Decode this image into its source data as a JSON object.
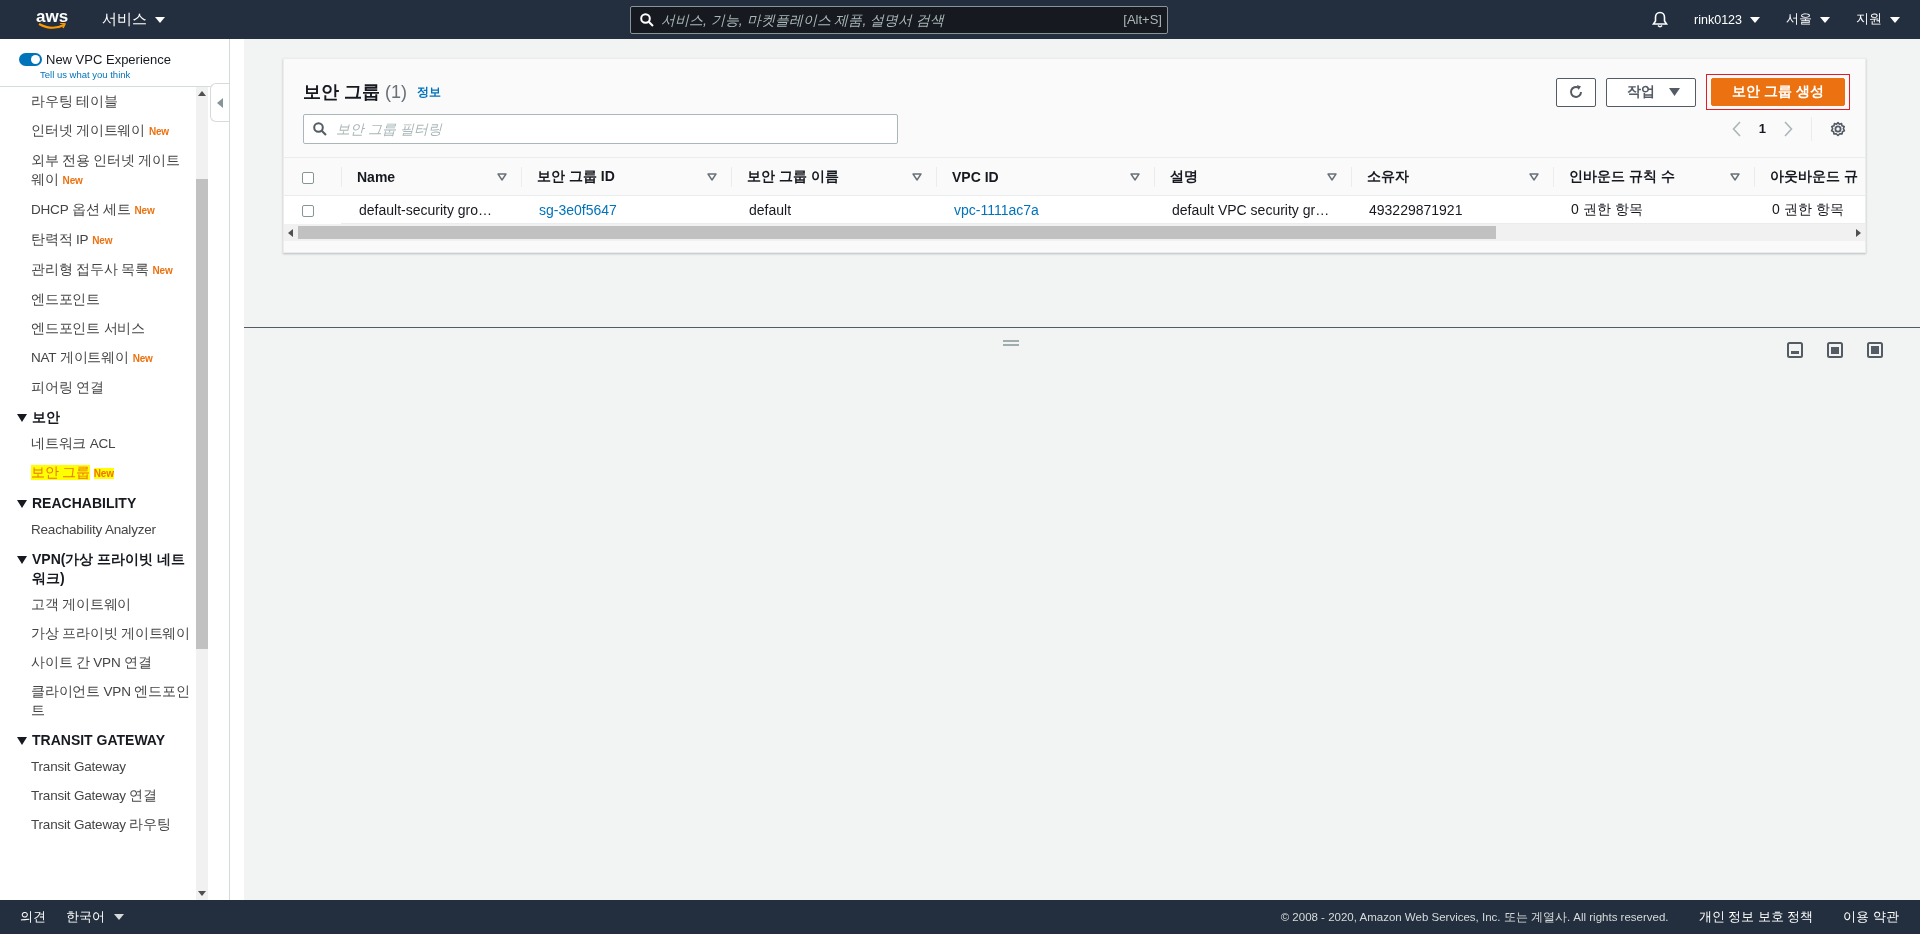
{
  "top_bar": {
    "logo": "aws",
    "services": "서비스",
    "search": {
      "placeholder": "서비스, 기능, 마켓플레이스 제품, 설명서 검색",
      "shortcut": "[Alt+S]"
    },
    "account": "rink0123",
    "region": "서울",
    "support": "지원"
  },
  "sidebar": {
    "toggle": {
      "label": "New VPC Experience",
      "on": true
    },
    "feedback_link": "Tell us what you think",
    "groups": [
      {
        "items": [
          {
            "label": "라우팅 테이블",
            "selected": false
          },
          {
            "label": "인터넷 게이트웨이",
            "badge": "New",
            "selected": false
          },
          {
            "label": "외부 전용 인터넷 게이트웨이",
            "badge": "New",
            "selected": false
          },
          {
            "label": "DHCP 옵션 세트",
            "badge": "New",
            "selected": false
          },
          {
            "label": "탄력적 IP",
            "badge": "New",
            "selected": false
          },
          {
            "label": "관리형 접두사 목록",
            "badge": "New",
            "selected": false
          },
          {
            "label": "엔드포인트",
            "selected": false
          },
          {
            "label": "엔드포인트 서비스",
            "selected": false
          },
          {
            "label": "NAT 게이트웨이",
            "badge": "New",
            "selected": false
          },
          {
            "label": "피어링 연결",
            "selected": false
          }
        ]
      },
      {
        "title": "보안",
        "expanded": true,
        "items": [
          {
            "label": "네트워크 ACL",
            "selected": false
          },
          {
            "label": "보안 그룹",
            "badge": "New",
            "selected": true
          }
        ]
      },
      {
        "title": "REACHABILITY",
        "expanded": true,
        "items": [
          {
            "label": "Reachability Analyzer",
            "selected": false
          }
        ]
      },
      {
        "title": "VPN(가상 프라이빗 네트워크)",
        "expanded": true,
        "items": [
          {
            "label": "고객 게이트웨이",
            "selected": false
          },
          {
            "label": "가상 프라이빗 게이트웨이",
            "selected": false
          },
          {
            "label": "사이트 간 VPN 연결",
            "selected": false
          },
          {
            "label": "클라이언트 VPN 엔드포인트",
            "selected": false
          }
        ]
      },
      {
        "title": "TRANSIT GATEWAY",
        "expanded": true,
        "items": [
          {
            "label": "Transit Gateway",
            "selected": false
          },
          {
            "label": "Transit Gateway 연결",
            "selected": false
          },
          {
            "label": "Transit Gateway 라우팅",
            "selected": false
          }
        ]
      }
    ]
  },
  "security_groups": {
    "title": "보안 그룹",
    "count": "(1)",
    "info_link": "정보",
    "actions_button": "작업",
    "create_button": "보안 그룹 생성",
    "filter": {
      "placeholder": "보안 그룹 필터링"
    },
    "page": "1",
    "select_all_checked": false,
    "columns": [
      "Name",
      "보안 그룹 ID",
      "보안 그룹 이름",
      "VPC ID",
      "설명",
      "소유자",
      "인바운드 규칙 수",
      "아웃바운드 규"
    ],
    "rows": [
      {
        "checked": false,
        "cells": [
          {
            "kind": "text",
            "text": "default-security gro…"
          },
          {
            "kind": "link",
            "text": "sg-3e0f5647"
          },
          {
            "kind": "text",
            "text": "default"
          },
          {
            "kind": "link",
            "text": "vpc-1111ac7a"
          },
          {
            "kind": "text",
            "text": "default VPC security gr…"
          },
          {
            "kind": "text",
            "text": "493229871921"
          },
          {
            "kind": "text",
            "text": "0 권한 항목"
          },
          {
            "kind": "text",
            "text": "0 권한 항목"
          }
        ]
      }
    ]
  },
  "footer": {
    "feedback": "의견",
    "language": "한국어",
    "copyright": "© 2008 - 2020, Amazon Web Services, Inc. 또는 계열사. All rights reserved.",
    "links": [
      "개인 정보 보호 정책",
      "이용 약관"
    ]
  }
}
